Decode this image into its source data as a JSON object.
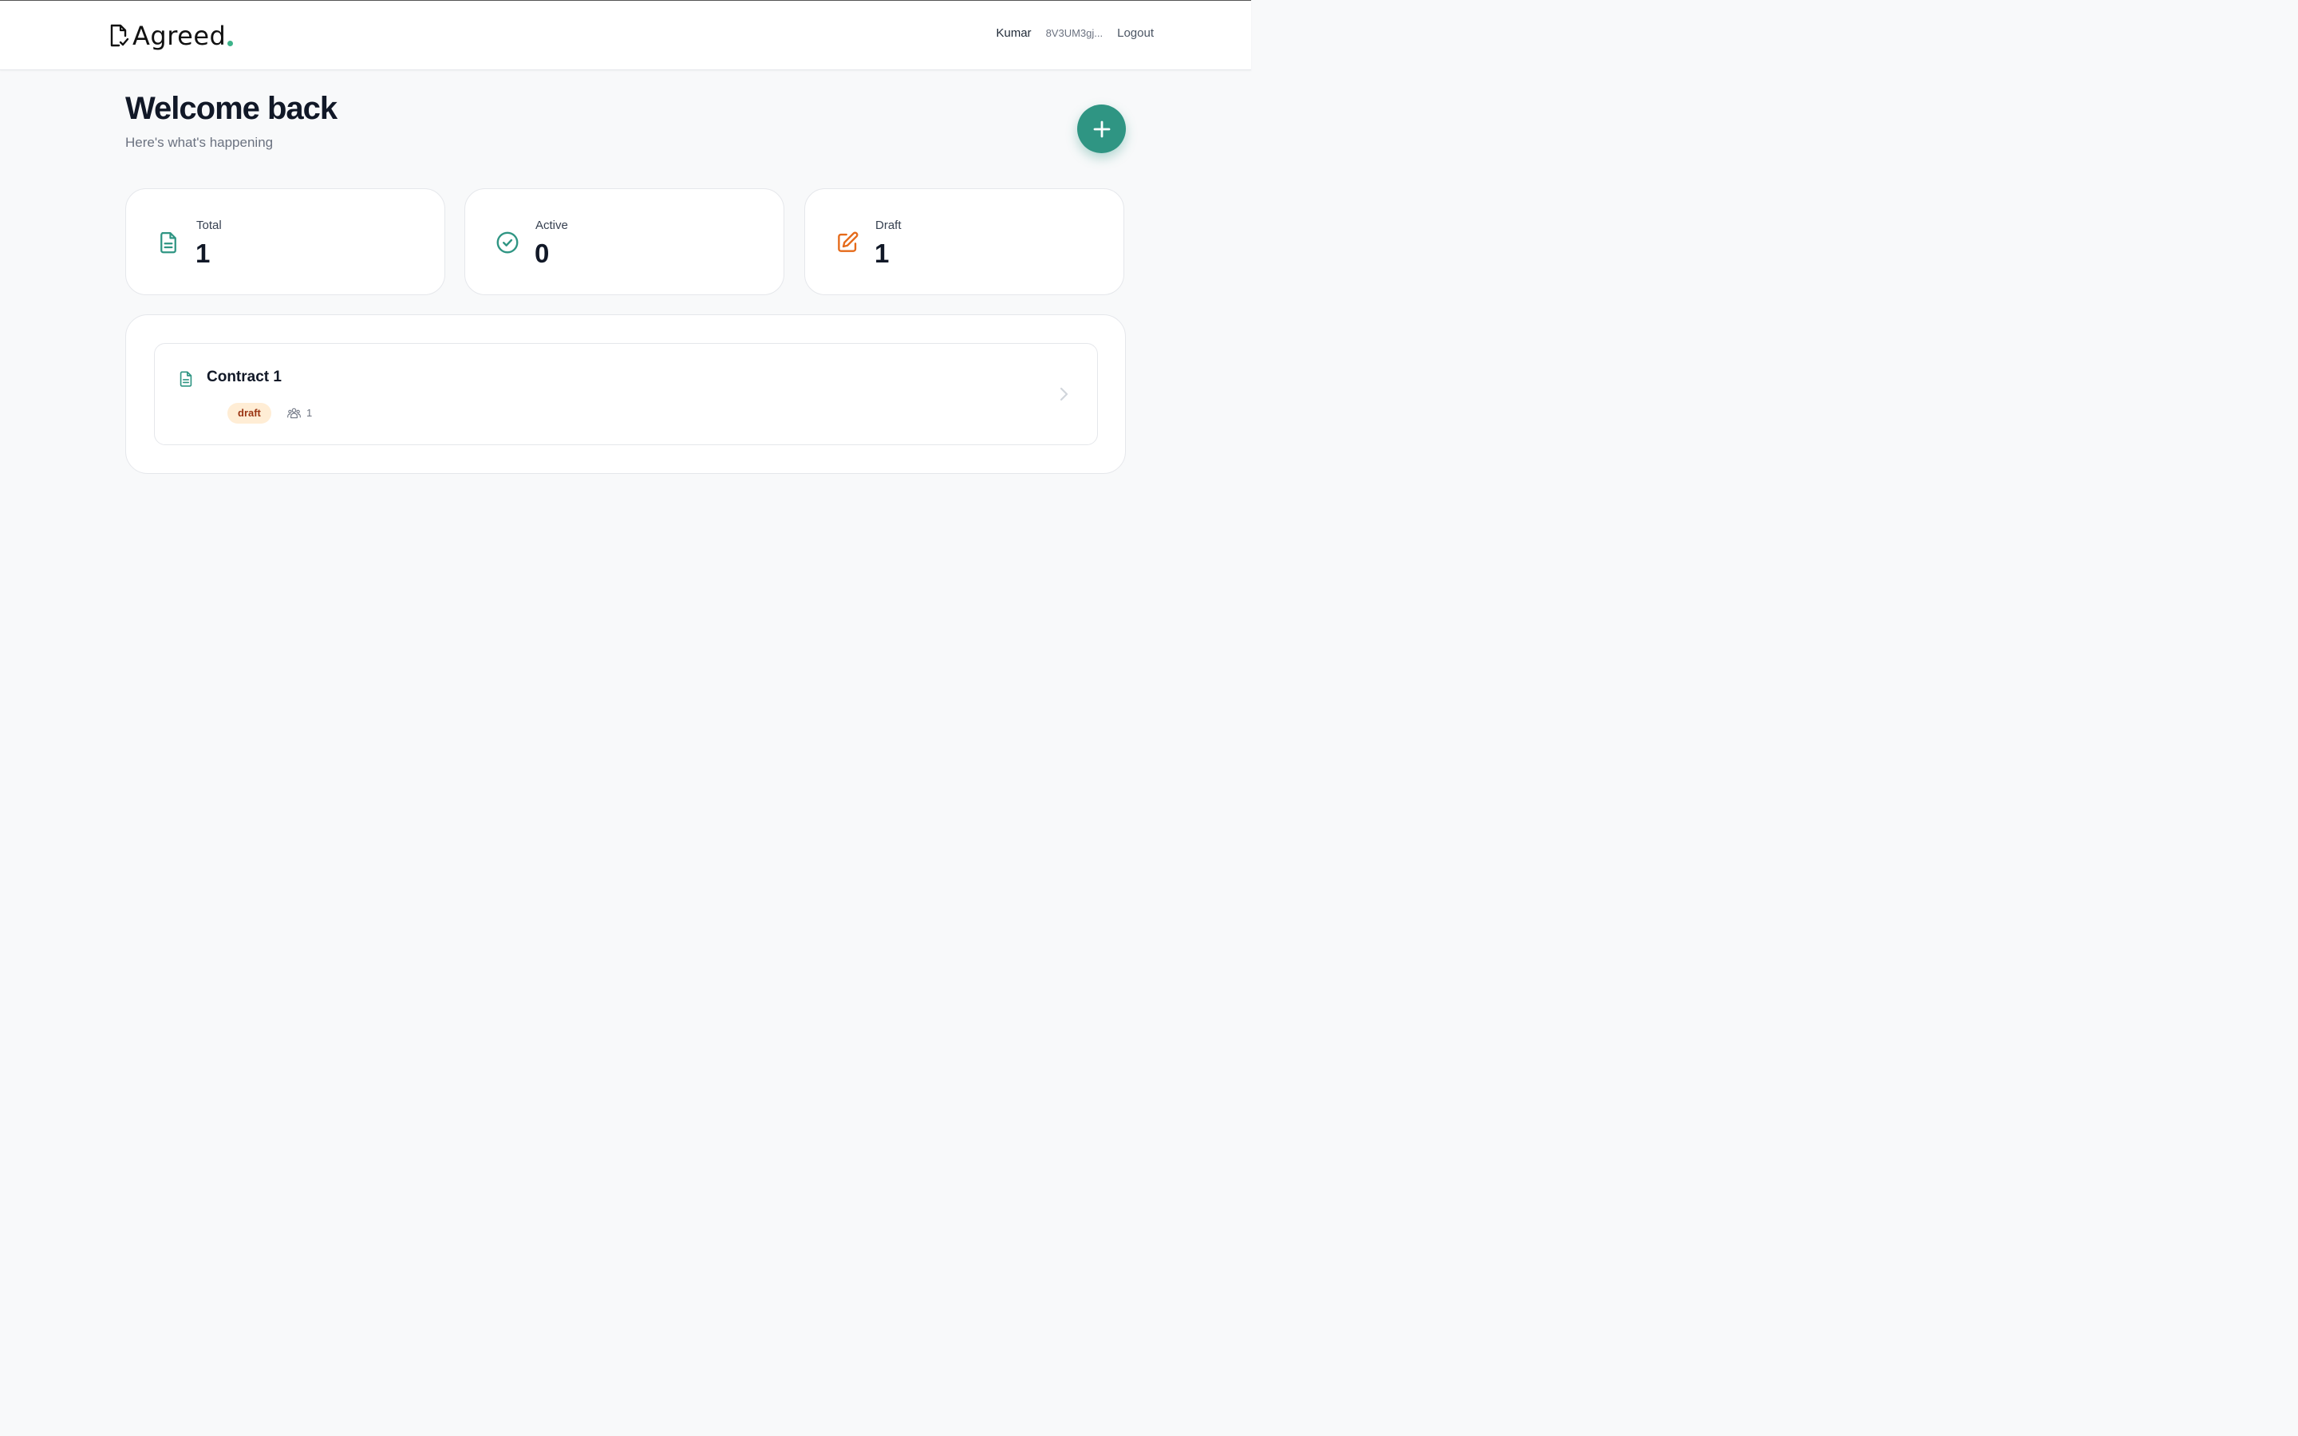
{
  "app": {
    "name": "Agreed"
  },
  "header": {
    "user_name": "Kumar",
    "wallet_address": "8V3UM3gj...",
    "logout_label": "Logout"
  },
  "page": {
    "title": "Welcome back",
    "subtitle": "Here's what's happening",
    "new_button_icon": "plus-icon"
  },
  "stats": [
    {
      "label": "Total",
      "value": "1",
      "icon": "document-icon",
      "color": "#2f9583"
    },
    {
      "label": "Active",
      "value": "0",
      "icon": "check-circle-icon",
      "color": "#2f9583"
    },
    {
      "label": "Draft",
      "value": "1",
      "icon": "edit-icon",
      "color": "#e56a1a"
    }
  ],
  "contracts": [
    {
      "title": "Contract 1",
      "status": "draft",
      "participants": "1",
      "icon": "document-icon"
    }
  ],
  "colors": {
    "accent": "#2f9583",
    "draft_badge_bg": "#ffedd5",
    "draft_badge_text": "#9a3412",
    "background": "#f8f9fa"
  }
}
